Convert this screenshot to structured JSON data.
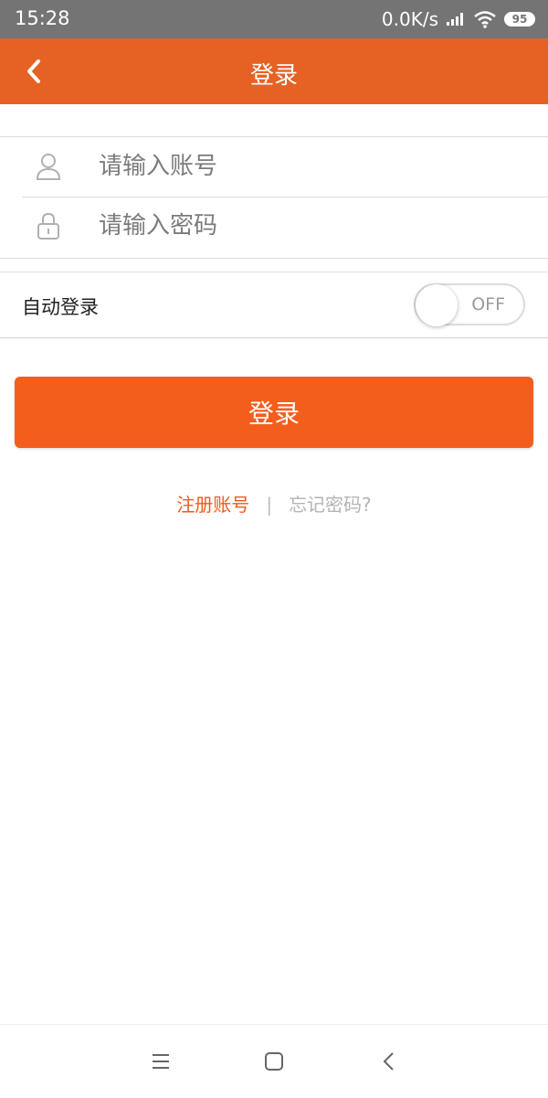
{
  "status_bar": {
    "time": "15:28",
    "network_speed": "0.0K/s",
    "battery": "95",
    "icons": [
      "signal-icon",
      "wifi-icon",
      "battery-icon"
    ]
  },
  "header": {
    "title": "登录",
    "back_icon": "back-arrow-icon",
    "background_color": "#e56224"
  },
  "form": {
    "account": {
      "placeholder": "请输入账号",
      "value": "",
      "icon": "user-icon"
    },
    "password": {
      "placeholder": "请输入密码",
      "value": "",
      "icon": "lock-icon"
    }
  },
  "auto_login": {
    "label": "自动登录",
    "toggle_text": "OFF",
    "enabled": false
  },
  "login_button": {
    "label": "登录",
    "color": "#f35e1c"
  },
  "links": {
    "register": "注册账号",
    "separator": "|",
    "forgot": "忘记密码?"
  },
  "bottom_nav": {
    "icons": [
      "menu-icon",
      "home-square-icon",
      "back-icon"
    ]
  }
}
